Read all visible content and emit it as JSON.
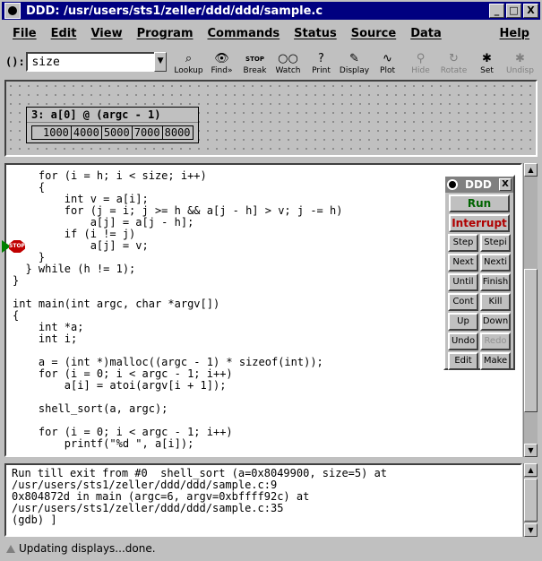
{
  "window": {
    "title": "DDD: /usr/users/sts1/zeller/ddd/ddd/sample.c",
    "controls": [
      "_",
      "□",
      "X"
    ]
  },
  "menubar": [
    "File",
    "Edit",
    "View",
    "Program",
    "Commands",
    "Status",
    "Source",
    "Data",
    "Help"
  ],
  "toolbar": {
    "arg_label": "():",
    "arg_value": "size",
    "tools": [
      {
        "label": "Lookup",
        "icon": "lookup-icon",
        "glyph": "⌕",
        "enabled": true
      },
      {
        "label": "Find»",
        "icon": "find-icon",
        "glyph": "👁",
        "enabled": true
      },
      {
        "label": "Break",
        "icon": "break-icon",
        "glyph": "STOP",
        "enabled": true
      },
      {
        "label": "Watch",
        "icon": "watch-icon",
        "glyph": "○○",
        "enabled": true
      },
      {
        "label": "Print",
        "icon": "print-icon",
        "glyph": "?",
        "enabled": true
      },
      {
        "label": "Display",
        "icon": "display-icon",
        "glyph": "✎",
        "enabled": true
      },
      {
        "label": "Plot",
        "icon": "plot-icon",
        "glyph": "∿",
        "enabled": true
      },
      {
        "label": "Hide",
        "icon": "hide-icon",
        "glyph": "⚲",
        "enabled": false
      },
      {
        "label": "Rotate",
        "icon": "rotate-icon",
        "glyph": "↻",
        "enabled": false
      },
      {
        "label": "Set",
        "icon": "set-icon",
        "glyph": "✱",
        "enabled": true
      },
      {
        "label": "Undisp",
        "icon": "undisp-icon",
        "glyph": "✱",
        "enabled": false
      }
    ]
  },
  "data_display": {
    "title": "3: a[0] @ (argc - 1)",
    "values": [
      "1000",
      "4000",
      "5000",
      "7000",
      "8000"
    ]
  },
  "source": {
    "lines": [
      "    for (i = h; i < size; i++)",
      "    {",
      "        int v = a[i];",
      "        for (j = i; j >= h && a[j - h] > v; j -= h)",
      "            a[j] = a[j - h];",
      "        if (i != j)",
      "            a[j] = v;",
      "    }",
      "  } while (h != 1);",
      "}",
      "",
      "int main(int argc, char *argv[])",
      "{",
      "    int *a;",
      "    int i;",
      "",
      "    a = (int *)malloc((argc - 1) * sizeof(int));",
      "    for (i = 0; i < argc - 1; i++)",
      "        a[i] = atoi(argv[i + 1]);",
      "",
      "    shell_sort(a, argc);",
      "",
      "    for (i = 0; i < argc - 1; i++)",
      "        printf(\"%d \", a[i]);"
    ],
    "breakpoint_glyph": "STOP"
  },
  "command_tool": {
    "title": "DDD",
    "close": "X",
    "run": "Run",
    "interrupt": "Interrupt",
    "buttons": [
      {
        "label": "Step",
        "enabled": true
      },
      {
        "label": "Stepi",
        "enabled": true
      },
      {
        "label": "Next",
        "enabled": true
      },
      {
        "label": "Nexti",
        "enabled": true
      },
      {
        "label": "Until",
        "enabled": true
      },
      {
        "label": "Finish",
        "enabled": true
      },
      {
        "label": "Cont",
        "enabled": true
      },
      {
        "label": "Kill",
        "enabled": true
      },
      {
        "label": "Up",
        "enabled": true
      },
      {
        "label": "Down",
        "enabled": true
      },
      {
        "label": "Undo",
        "enabled": true
      },
      {
        "label": "Redo",
        "enabled": false
      },
      {
        "label": "Edit",
        "enabled": true
      },
      {
        "label": "Make",
        "enabled": true
      }
    ],
    "colors": {
      "run": "#006400",
      "interrupt": "#b00000"
    }
  },
  "console": {
    "lines": [
      "Run till exit from #0  shell_sort (a=0x8049900, size=5) at",
      "/usr/users/sts1/zeller/ddd/ddd/sample.c:9",
      "0x804872d in main (argc=6, argv=0xbffff92c) at",
      "/usr/users/sts1/zeller/ddd/ddd/sample.c:35",
      "(gdb) ]"
    ]
  },
  "status": {
    "text": "Updating displays...done."
  }
}
